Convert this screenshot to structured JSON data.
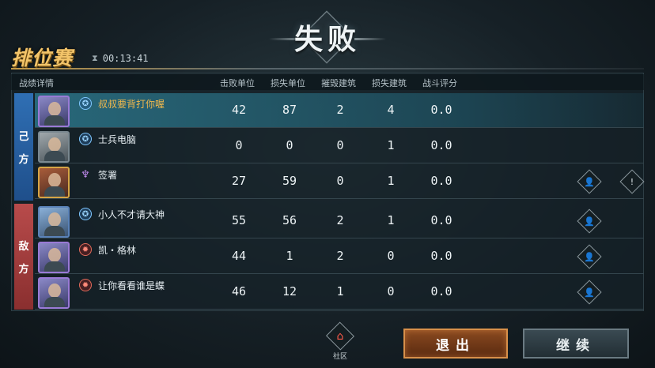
{
  "result": {
    "title": "失败"
  },
  "mode": {
    "title": "排位赛",
    "timer": "00:13:41"
  },
  "table": {
    "section_label": "战绩详情",
    "columns": [
      "击败单位",
      "损失单位",
      "摧毁建筑",
      "损失建筑",
      "战斗评分"
    ]
  },
  "teams": {
    "own_label": [
      "己",
      "方"
    ],
    "enemy_label": [
      "敌",
      "方"
    ]
  },
  "players": [
    {
      "name": "叔叔要背打你喔",
      "kills": "42",
      "losses": "87",
      "destroyed": "2",
      "lost_buildings": "4",
      "score": "0.0"
    },
    {
      "name": "士兵电脑",
      "kills": "0",
      "losses": "0",
      "destroyed": "0",
      "lost_buildings": "1",
      "score": "0.0"
    },
    {
      "name": "签署",
      "kills": "27",
      "losses": "59",
      "destroyed": "0",
      "lost_buildings": "1",
      "score": "0.0"
    },
    {
      "name": "小人不才请大神",
      "kills": "55",
      "losses": "56",
      "destroyed": "2",
      "lost_buildings": "1",
      "score": "0.0"
    },
    {
      "name": "凯・格林",
      "kills": "44",
      "losses": "1",
      "destroyed": "2",
      "lost_buildings": "0",
      "score": "0.0"
    },
    {
      "name": "让你看看谁是蝶",
      "kills": "46",
      "losses": "12",
      "destroyed": "1",
      "lost_buildings": "0",
      "score": "0.0"
    }
  ],
  "footer": {
    "community_label": "社区",
    "exit_label": "退出",
    "continue_label": "继续"
  },
  "colors": {
    "accent_gold": "#f0b84d",
    "own_team": "#2f6fb4",
    "enemy_team": "#b84b4b",
    "exit_border": "#d8904a"
  },
  "icons": {
    "allied": "allied-faction-icon",
    "psi": "psi-faction-icon",
    "soviet": "soviet-faction-icon",
    "friend": "add-friend-icon",
    "report": "report-icon",
    "community": "home-icon",
    "timer": "hourglass-icon"
  }
}
